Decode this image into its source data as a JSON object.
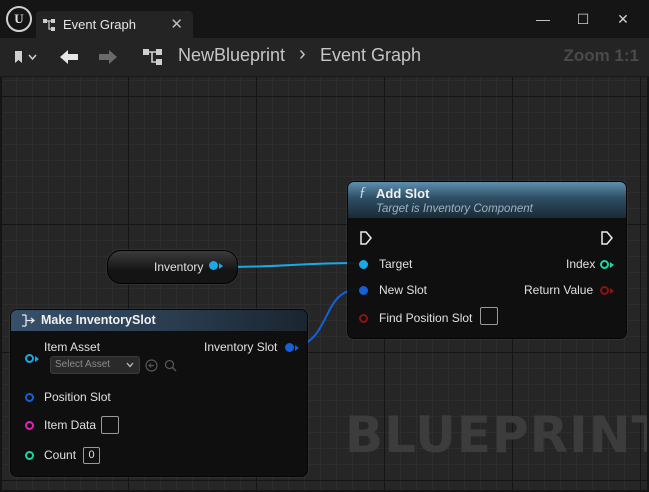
{
  "window": {
    "tab_title": "Event Graph",
    "close_symbol": "✕",
    "minimize_symbol": "—",
    "maximize_symbol": "☐",
    "window_close_symbol": "✕"
  },
  "toolbar": {
    "breadcrumb": [
      "NewBlueprint",
      "Event Graph"
    ],
    "breadcrumb_separator": "›",
    "zoom": "Zoom 1:1"
  },
  "graph": {
    "watermark": "BLUEPRINT",
    "variable_node": {
      "label": "Inventory",
      "pin_color": "#1aa9e6"
    },
    "add_slot_node": {
      "title": "Add Slot",
      "subtitle": "Target is Inventory Component",
      "inputs": [
        {
          "label": "Target",
          "color": "#1aa9e6"
        },
        {
          "label": "New Slot",
          "color": "#1460d8"
        },
        {
          "label": "Find Position Slot",
          "color": "#8a1414"
        }
      ],
      "outputs": [
        {
          "label": "Index",
          "color": "#1ed6a4"
        },
        {
          "label": "Return Value",
          "color": "#8a1414"
        }
      ]
    },
    "make_node": {
      "title": "Make InventorySlot",
      "asset_placeholder": "Select Asset",
      "inputs": [
        {
          "label": "Item Asset",
          "color": "#1aa9e6"
        },
        {
          "label": "Position Slot",
          "color": "#1460d8"
        },
        {
          "label": "Item Data",
          "color": "#e021b6"
        },
        {
          "label": "Count",
          "color": "#1ed6a4",
          "value": "0"
        }
      ],
      "output": {
        "label": "Inventory Slot",
        "color": "#1460d8"
      }
    }
  }
}
